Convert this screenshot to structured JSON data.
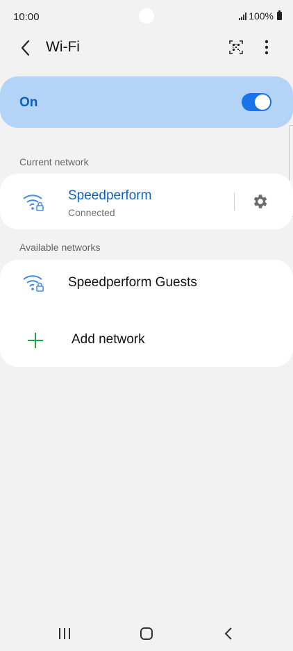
{
  "status_bar": {
    "time": "10:00",
    "battery": "100%"
  },
  "header": {
    "title": "Wi-Fi",
    "back_icon": "chevron-left-icon",
    "qr_icon": "qr-code-scan-icon",
    "more_icon": "more-vertical-icon"
  },
  "master": {
    "label": "On",
    "enabled": true
  },
  "current_section": {
    "heading": "Current network",
    "network": {
      "name": "Speedperform",
      "status": "Connected",
      "icon": "wifi-locked-icon",
      "settings_icon": "gear-icon"
    }
  },
  "available_section": {
    "heading": "Available networks",
    "networks": [
      {
        "name": "Speedperform Guests",
        "icon": "wifi-locked-icon"
      }
    ],
    "add_label": "Add network",
    "add_icon": "plus-icon"
  },
  "colors": {
    "accent": "#0b61c2",
    "toggle_on": "#1a73e8",
    "master_bg": "#b3d3f7",
    "add_green": "#1fa34a",
    "wifi_blue": "#3d8be0"
  }
}
